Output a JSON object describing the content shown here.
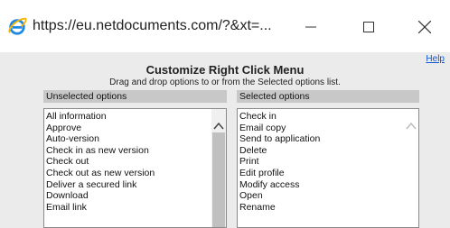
{
  "window": {
    "url_title": "https://eu.netdocuments.com/?&xt=...",
    "icon": "internet-explorer-icon"
  },
  "dialog": {
    "help_label": "Help",
    "title": "Customize Right Click Menu",
    "subtitle": "Drag and drop options to or from the Selected options list."
  },
  "unselected": {
    "header": "Unselected options",
    "items": [
      "All information",
      "Approve",
      "Auto-version",
      "Check in as new version",
      "Check out",
      "Check out as new version",
      "Deliver a secured link",
      "Download",
      "Email link"
    ]
  },
  "selected": {
    "header": "Selected options",
    "items": [
      "Check in",
      "Email copy",
      "Send to application",
      "Delete",
      "Print",
      "Edit profile",
      "Modify access",
      "Open",
      "Rename"
    ]
  },
  "colors": {
    "dialog_bg": "#ebebeb",
    "header_bg": "#c8c8c8",
    "link": "#0b57d0"
  }
}
